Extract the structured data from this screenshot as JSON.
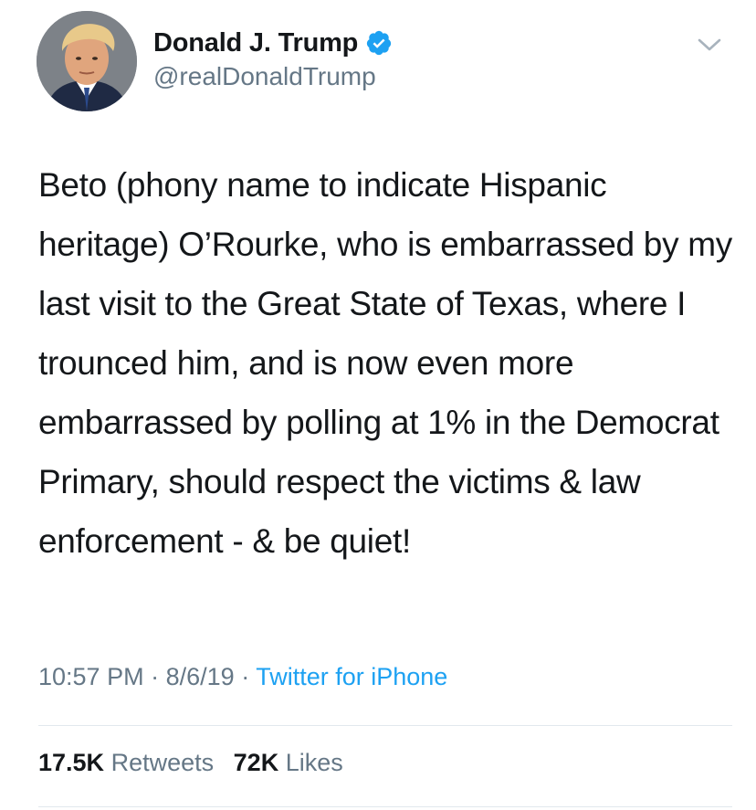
{
  "author": {
    "display_name": "Donald J. Trump",
    "handle": "@realDonaldTrump",
    "verified": true,
    "avatar_icon": "profile-photo"
  },
  "menu": {
    "icon": "chevron-down-icon"
  },
  "tweet": {
    "text": "Beto (phony name to indicate Hispanic heritage) O’Rourke, who is embarrassed by my last visit to the Great State of Texas, where I trounced him, and is now even more embarrassed by polling at 1% in the Democrat Primary, should respect the victims & law enforcement - & be quiet!",
    "time": "10:57 PM",
    "date": "8/6/19",
    "separator": "·",
    "source": "Twitter for iPhone"
  },
  "stats": {
    "retweets_count": "17.5K",
    "retweets_label": "Retweets",
    "likes_count": "72K",
    "likes_label": "Likes"
  },
  "colors": {
    "text": "#14171a",
    "secondary": "#657786",
    "accent": "#1da1f2",
    "divider": "#e1e8ed"
  }
}
